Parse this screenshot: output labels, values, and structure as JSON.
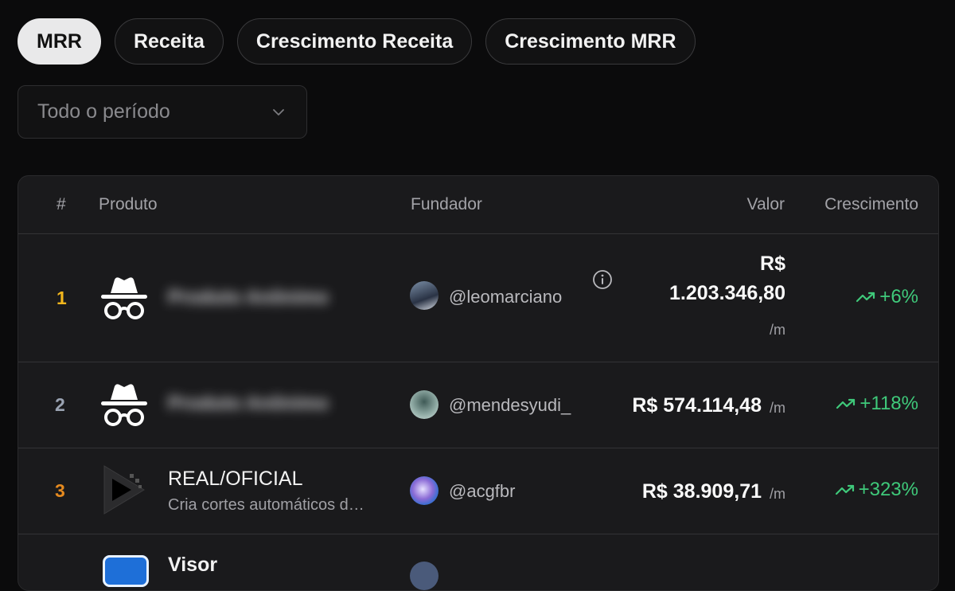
{
  "tabs": [
    {
      "label": "MRR"
    },
    {
      "label": "Receita"
    },
    {
      "label": "Crescimento Receita"
    },
    {
      "label": "Crescimento MRR"
    }
  ],
  "period_select": {
    "value": "Todo o período",
    "icon": "chevron-down-icon"
  },
  "table": {
    "headers": {
      "rank": "#",
      "product": "Produto",
      "founder": "Fundador",
      "value": "Valor",
      "growth": "Crescimento"
    },
    "rows": [
      {
        "rank": "1",
        "product_name": "Produto Anônimo",
        "founder": "@leomarciano",
        "value_currency": "R$",
        "value_amount": "1.203.346,80",
        "per": "/m",
        "growth": "+6%"
      },
      {
        "rank": "2",
        "product_name": "Produto Anônimo",
        "founder": "@mendesyudi_",
        "value": "R$ 574.114,48",
        "per": "/m",
        "growth": "+118%"
      },
      {
        "rank": "3",
        "product_name": "REAL/OFICIAL",
        "product_desc": "Cria cortes automáticos d…",
        "founder": "@acgfbr",
        "value": "R$ 38.909,71",
        "per": "/m",
        "growth": "+323%"
      },
      {
        "product_name": "Visor"
      }
    ]
  },
  "colors": {
    "rank1": "#f3b71c",
    "rank2": "#9aa3b2",
    "rank3": "#e58a1f",
    "growth": "#3fc97a",
    "active_tab": "#e9e9ea"
  }
}
